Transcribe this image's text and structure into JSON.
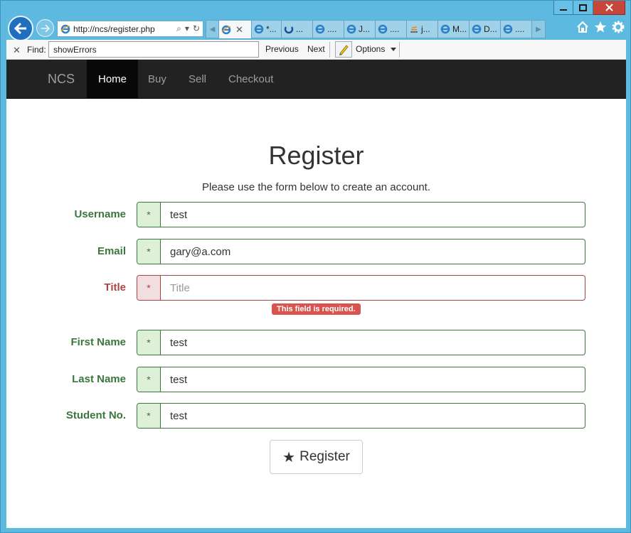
{
  "browser": {
    "address": {
      "url": "http://ncs/register.php"
    },
    "tabs": [
      {
        "label": "",
        "active": true
      },
      {
        "label": "*..."
      },
      {
        "label": "..."
      },
      {
        "label": "...."
      },
      {
        "label": "J..."
      },
      {
        "label": "...."
      },
      {
        "label": "j..."
      },
      {
        "label": "M..."
      },
      {
        "label": "D..."
      },
      {
        "label": "...."
      }
    ],
    "find": {
      "label": "Find:",
      "value": "showErrors",
      "previous": "Previous",
      "next": "Next",
      "options": "Options"
    }
  },
  "navbar": {
    "brand": "NCS",
    "items": [
      {
        "label": "Home",
        "active": true
      },
      {
        "label": "Buy"
      },
      {
        "label": "Sell"
      },
      {
        "label": "Checkout"
      }
    ]
  },
  "form": {
    "title": "Register",
    "subtitle": "Please use the form below to create an account.",
    "fields": [
      {
        "label": "Username",
        "value": "test",
        "addon": "*",
        "state": "valid"
      },
      {
        "label": "Email",
        "value": "gary@a.com",
        "addon": "*",
        "state": "valid"
      },
      {
        "label": "Title",
        "value": "",
        "placeholder": "Title",
        "addon": "*",
        "state": "error",
        "error": "This field is required."
      },
      {
        "label": "First Name",
        "value": "test",
        "addon": "*",
        "state": "valid"
      },
      {
        "label": "Last Name",
        "value": "test",
        "addon": "*",
        "state": "valid"
      },
      {
        "label": "Student No.",
        "value": "test",
        "addon": "*",
        "state": "valid"
      }
    ],
    "submit": {
      "icon": "star-icon",
      "label": "Register"
    }
  },
  "colors": {
    "success": "#3c763d",
    "success_bg": "#dff0d8",
    "error": "#a94442",
    "error_bg": "#f2dede",
    "error_badge": "#d9534f",
    "navbar": "#222222"
  }
}
